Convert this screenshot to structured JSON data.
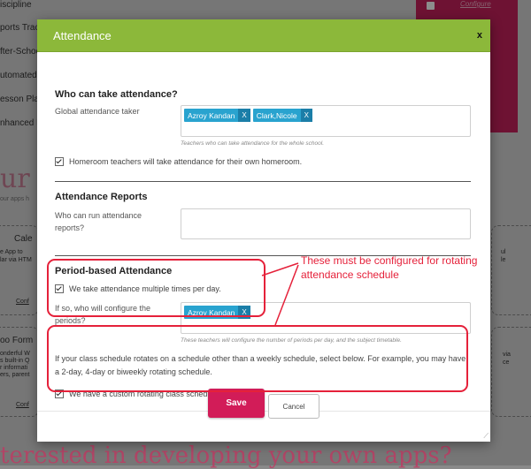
{
  "background": {
    "rows": [
      "iscipline",
      "ports Trac",
      "fter-Schoo",
      "utomated",
      "esson Plan",
      "nhanced F"
    ],
    "pink_panel": {
      "configure_label": "Configure"
    },
    "big_fragment": "ur A",
    "small_fragment": "our apps h",
    "card1": {
      "title": "Cale",
      "lines": [
        "e App to",
        "lar via HTM"
      ],
      "link": "Conf",
      "right": [
        "ul",
        "le"
      ]
    },
    "card2": {
      "title": "oo Form",
      "lines": [
        "onderful W",
        "s built-in Q",
        "r informati",
        "ers, parent"
      ],
      "link": "Conf",
      "right": [
        "via",
        "ce"
      ]
    },
    "bottom_text": "terested in developing your own apps?"
  },
  "modal": {
    "title": "Attendance",
    "close_label": "x",
    "who_can_take": {
      "title": "Who can take attendance?",
      "global_label": "Global attendance taker",
      "tags": [
        "Azroy Kandan",
        "Clark,Nicole"
      ],
      "tag_remove": "X",
      "hint": "Teachers who can take attendance for the whole school.",
      "homeroom_label": "Homeroom teachers will take attendance for their own homeroom."
    },
    "reports": {
      "title": "Attendance Reports",
      "run_label": "Who can run attendance reports?"
    },
    "period": {
      "title": "Period-based Attendance",
      "multiple_label": "We take attendance multiple times per day.",
      "configure_label": "If so, who will configure the periods?",
      "tags": [
        "Azroy Kandan"
      ],
      "tag_remove": "X",
      "hint": "These teachers will configure the number of periods per day, and the subject timetable."
    },
    "rotating": {
      "text": "If your class schedule rotates on a schedule other than a weekly schedule, select below. For example, you may have a 2-day, 4-day or biweekly rotating schedule.",
      "custom_label": "We have a custom rotating class schedule."
    },
    "save_label": "Save",
    "cancel_label": "Cancel"
  },
  "annotation": {
    "text": "These must be configured for rotating attendance schedule",
    "color": "#e5213a"
  },
  "colors": {
    "header": "#8cb83a",
    "save": "#d21c58",
    "tag": "#29a3cf",
    "accent_pink": "#c8215e"
  }
}
